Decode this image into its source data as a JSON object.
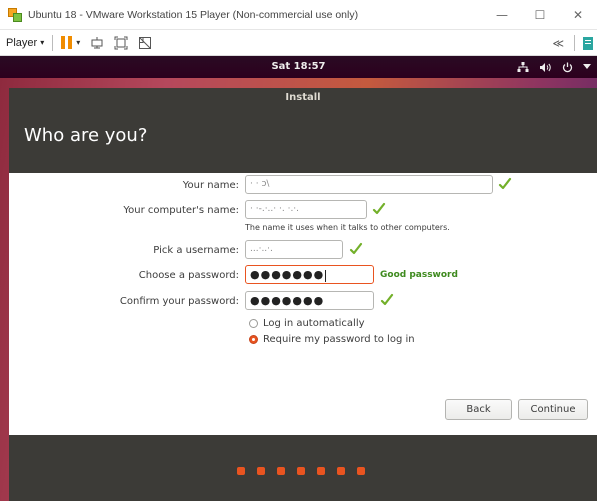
{
  "window": {
    "title": "Ubuntu 18 - VMware Workstation 15 Player (Non-commercial use only)",
    "minimize_glyph": "—",
    "maximize_glyph": "☐",
    "close_glyph": "✕"
  },
  "toolbar": {
    "player_label": "Player",
    "caret": "▾",
    "collapse_glyph": "≪"
  },
  "panel": {
    "clock": "Sat 18:57"
  },
  "installer": {
    "window_title": "Install",
    "heading": "Who are you?",
    "form": {
      "your_name_label": "Your name:",
      "your_name_value": "  ·    ·  ɔ\\",
      "computer_name_label": "Your computer's name:",
      "computer_name_value": "·  ·-.·..·  ·. ·.·.",
      "computer_name_hint": "The name it uses when it talks to other computers.",
      "username_label": "Pick a username:",
      "username_value": "...·..·.",
      "password_label": "Choose a password:",
      "password_value": "●●●●●●●",
      "password_strength": "Good password",
      "confirm_label": "Confirm your password:",
      "confirm_value": "●●●●●●●",
      "login_auto_label": "Log in automatically",
      "login_password_label": "Require my password to log in",
      "selected_login_option": "Require my password to log in"
    },
    "buttons": {
      "back": "Back",
      "continue": "Continue"
    },
    "progress_steps": 7
  },
  "colors": {
    "accent": "#e95420",
    "panel": "#2c001e",
    "installer_chrome": "#3c3b37",
    "check": "#73b02a",
    "good_password": "#3e8a1e",
    "pause": "#f08c00"
  }
}
